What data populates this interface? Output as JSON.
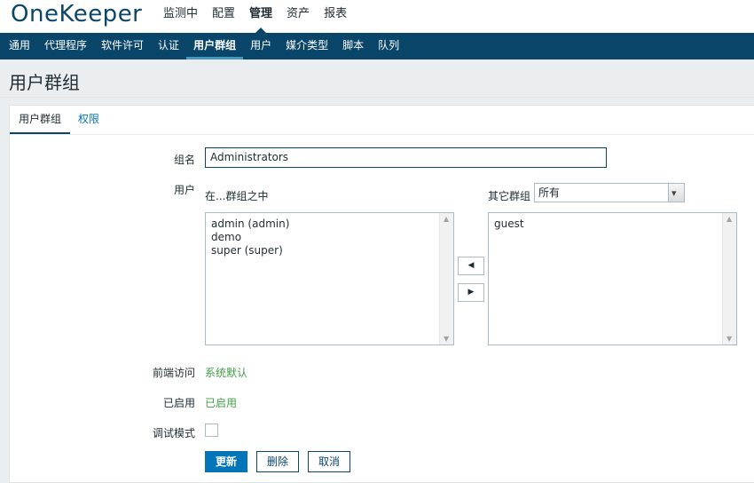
{
  "app": {
    "logo": "OneKeeper"
  },
  "top_menu": [
    {
      "label": "监测中"
    },
    {
      "label": "配置"
    },
    {
      "label": "管理"
    },
    {
      "label": "资产"
    },
    {
      "label": "报表"
    }
  ],
  "sub_menu": [
    {
      "label": "通用"
    },
    {
      "label": "代理程序"
    },
    {
      "label": "软件许可"
    },
    {
      "label": "认证"
    },
    {
      "label": "用户群组"
    },
    {
      "label": "用户"
    },
    {
      "label": "媒介类型"
    },
    {
      "label": "脚本"
    },
    {
      "label": "队列"
    }
  ],
  "page": {
    "title": "用户群组"
  },
  "tabs": {
    "group": "用户群组",
    "permissions": "权限"
  },
  "form": {
    "group_name_label": "组名",
    "group_name_value": "Administrators",
    "users_label": "用户",
    "in_group_label": "在...群组之中",
    "other_groups_label": "其它群组",
    "other_groups_selected": "所有",
    "in_group_users": [
      "admin (admin)",
      "demo",
      "super (super)"
    ],
    "other_users": [
      "guest"
    ],
    "move_left_icon": "◀",
    "move_right_icon": "▶",
    "frontend_access_label": "前端访问",
    "frontend_access_value": "系统默认",
    "enabled_label": "已启用",
    "enabled_value": "已启用",
    "debug_label": "调试模式",
    "debug_checked": false
  },
  "buttons": {
    "update": "更新",
    "delete": "删除",
    "cancel": "取消"
  },
  "colors": {
    "header": "#0a466a",
    "primary": "#0275b8",
    "success": "#429e47"
  }
}
